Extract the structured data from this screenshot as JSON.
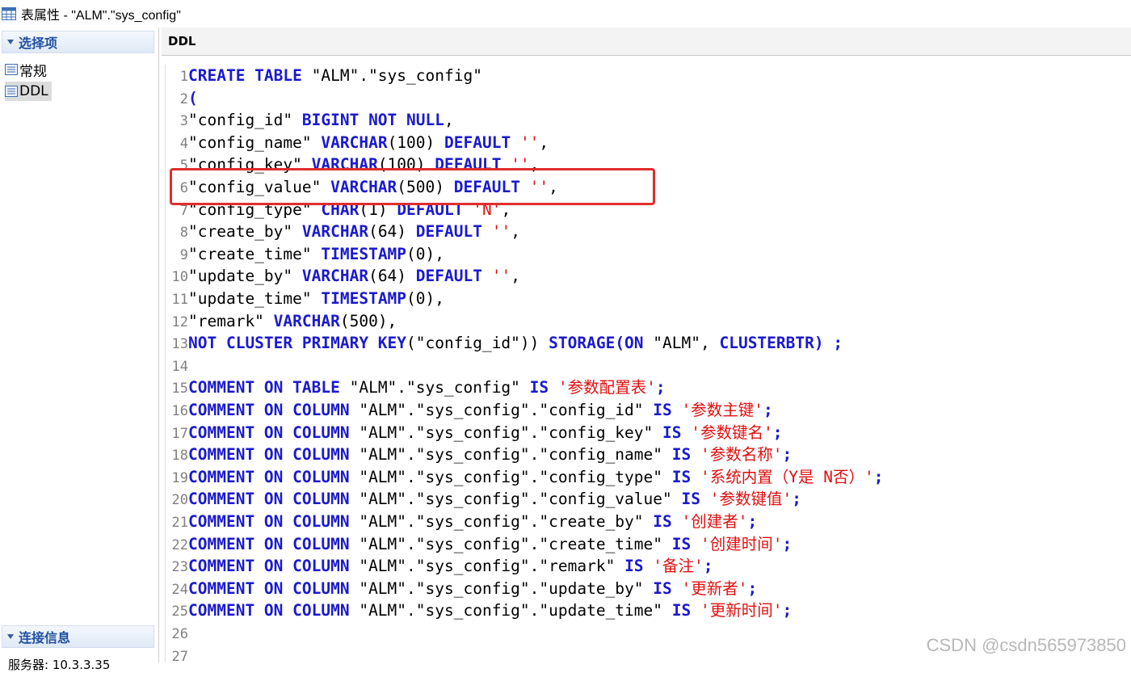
{
  "window": {
    "title": "表属性 - \"ALM\".\"sys_config\""
  },
  "sidebar": {
    "section_options": "选择项",
    "items": [
      {
        "label": "常规"
      },
      {
        "label": "DDL"
      }
    ],
    "section_connection": "连接信息",
    "connection_partial": "服务器: 10.3.3.35"
  },
  "tab": {
    "label": "DDL"
  },
  "ddl_lines": [
    [
      {
        "t": "CREATE TABLE ",
        "c": "kw"
      },
      {
        "t": "\"ALM\".\"sys_config\"",
        "c": "code"
      }
    ],
    [
      {
        "t": "(",
        "c": "kw"
      }
    ],
    [
      {
        "t": "\"config_id\" ",
        "c": "code"
      },
      {
        "t": "BIGINT NOT NULL",
        "c": "kw"
      },
      {
        "t": ",",
        "c": "code"
      }
    ],
    [
      {
        "t": "\"config_name\" ",
        "c": "code"
      },
      {
        "t": "VARCHAR",
        "c": "kw"
      },
      {
        "t": "(100) ",
        "c": "code"
      },
      {
        "t": "DEFAULT ",
        "c": "kw"
      },
      {
        "t": "''",
        "c": "str"
      },
      {
        "t": ",",
        "c": "code"
      }
    ],
    [
      {
        "t": "\"config_key\" ",
        "c": "code"
      },
      {
        "t": "VARCHAR",
        "c": "kw"
      },
      {
        "t": "(100) ",
        "c": "code"
      },
      {
        "t": "DEFAULT ",
        "c": "kw"
      },
      {
        "t": "''",
        "c": "str"
      },
      {
        "t": ",",
        "c": "code"
      }
    ],
    [
      {
        "t": "\"config_value\" ",
        "c": "code"
      },
      {
        "t": "VARCHAR",
        "c": "kw"
      },
      {
        "t": "(500) ",
        "c": "code"
      },
      {
        "t": "DEFAULT ",
        "c": "kw"
      },
      {
        "t": "''",
        "c": "str"
      },
      {
        "t": ",",
        "c": "code"
      }
    ],
    [
      {
        "t": "\"config_type\" ",
        "c": "code"
      },
      {
        "t": "CHAR",
        "c": "kw"
      },
      {
        "t": "(1) ",
        "c": "code"
      },
      {
        "t": "DEFAULT ",
        "c": "kw"
      },
      {
        "t": "'N'",
        "c": "str"
      },
      {
        "t": ",",
        "c": "code"
      }
    ],
    [
      {
        "t": "\"create_by\" ",
        "c": "code"
      },
      {
        "t": "VARCHAR",
        "c": "kw"
      },
      {
        "t": "(64) ",
        "c": "code"
      },
      {
        "t": "DEFAULT ",
        "c": "kw"
      },
      {
        "t": "''",
        "c": "str"
      },
      {
        "t": ",",
        "c": "code"
      }
    ],
    [
      {
        "t": "\"create_time\" ",
        "c": "code"
      },
      {
        "t": "TIMESTAMP",
        "c": "kw"
      },
      {
        "t": "(0),",
        "c": "code"
      }
    ],
    [
      {
        "t": "\"update_by\" ",
        "c": "code"
      },
      {
        "t": "VARCHAR",
        "c": "kw"
      },
      {
        "t": "(64) ",
        "c": "code"
      },
      {
        "t": "DEFAULT ",
        "c": "kw"
      },
      {
        "t": "''",
        "c": "str"
      },
      {
        "t": ",",
        "c": "code"
      }
    ],
    [
      {
        "t": "\"update_time\" ",
        "c": "code"
      },
      {
        "t": "TIMESTAMP",
        "c": "kw"
      },
      {
        "t": "(0),",
        "c": "code"
      }
    ],
    [
      {
        "t": "\"remark\" ",
        "c": "code"
      },
      {
        "t": "VARCHAR",
        "c": "kw"
      },
      {
        "t": "(500),",
        "c": "code"
      }
    ],
    [
      {
        "t": "NOT CLUSTER PRIMARY KEY",
        "c": "kw"
      },
      {
        "t": "(\"config_id\")) ",
        "c": "code"
      },
      {
        "t": "STORAGE(ON ",
        "c": "kw"
      },
      {
        "t": "\"ALM\", ",
        "c": "code"
      },
      {
        "t": "CLUSTERBTR) ;",
        "c": "kw"
      }
    ],
    [],
    [
      {
        "t": "COMMENT ON TABLE ",
        "c": "kw"
      },
      {
        "t": "\"ALM\".\"sys_config\" ",
        "c": "code"
      },
      {
        "t": "IS ",
        "c": "kw"
      },
      {
        "t": "'参数配置表'",
        "c": "str"
      },
      {
        "t": ";",
        "c": "kw"
      }
    ],
    [
      {
        "t": "COMMENT ON COLUMN ",
        "c": "kw"
      },
      {
        "t": "\"ALM\".\"sys_config\".\"config_id\" ",
        "c": "code"
      },
      {
        "t": "IS ",
        "c": "kw"
      },
      {
        "t": "'参数主键'",
        "c": "str"
      },
      {
        "t": ";",
        "c": "kw"
      }
    ],
    [
      {
        "t": "COMMENT ON COLUMN ",
        "c": "kw"
      },
      {
        "t": "\"ALM\".\"sys_config\".\"config_key\" ",
        "c": "code"
      },
      {
        "t": "IS ",
        "c": "kw"
      },
      {
        "t": "'参数键名'",
        "c": "str"
      },
      {
        "t": ";",
        "c": "kw"
      }
    ],
    [
      {
        "t": "COMMENT ON COLUMN ",
        "c": "kw"
      },
      {
        "t": "\"ALM\".\"sys_config\".\"config_name\" ",
        "c": "code"
      },
      {
        "t": "IS ",
        "c": "kw"
      },
      {
        "t": "'参数名称'",
        "c": "str"
      },
      {
        "t": ";",
        "c": "kw"
      }
    ],
    [
      {
        "t": "COMMENT ON COLUMN ",
        "c": "kw"
      },
      {
        "t": "\"ALM\".\"sys_config\".\"config_type\" ",
        "c": "code"
      },
      {
        "t": "IS ",
        "c": "kw"
      },
      {
        "t": "'系统内置（Y是 N否）'",
        "c": "str"
      },
      {
        "t": ";",
        "c": "kw"
      }
    ],
    [
      {
        "t": "COMMENT ON COLUMN ",
        "c": "kw"
      },
      {
        "t": "\"ALM\".\"sys_config\".\"config_value\" ",
        "c": "code"
      },
      {
        "t": "IS ",
        "c": "kw"
      },
      {
        "t": "'参数键值'",
        "c": "str"
      },
      {
        "t": ";",
        "c": "kw"
      }
    ],
    [
      {
        "t": "COMMENT ON COLUMN ",
        "c": "kw"
      },
      {
        "t": "\"ALM\".\"sys_config\".\"create_by\" ",
        "c": "code"
      },
      {
        "t": "IS ",
        "c": "kw"
      },
      {
        "t": "'创建者'",
        "c": "str"
      },
      {
        "t": ";",
        "c": "kw"
      }
    ],
    [
      {
        "t": "COMMENT ON COLUMN ",
        "c": "kw"
      },
      {
        "t": "\"ALM\".\"sys_config\".\"create_time\" ",
        "c": "code"
      },
      {
        "t": "IS ",
        "c": "kw"
      },
      {
        "t": "'创建时间'",
        "c": "str"
      },
      {
        "t": ";",
        "c": "kw"
      }
    ],
    [
      {
        "t": "COMMENT ON COLUMN ",
        "c": "kw"
      },
      {
        "t": "\"ALM\".\"sys_config\".\"remark\" ",
        "c": "code"
      },
      {
        "t": "IS ",
        "c": "kw"
      },
      {
        "t": "'备注'",
        "c": "str"
      },
      {
        "t": ";",
        "c": "kw"
      }
    ],
    [
      {
        "t": "COMMENT ON COLUMN ",
        "c": "kw"
      },
      {
        "t": "\"ALM\".\"sys_config\".\"update_by\" ",
        "c": "code"
      },
      {
        "t": "IS ",
        "c": "kw"
      },
      {
        "t": "'更新者'",
        "c": "str"
      },
      {
        "t": ";",
        "c": "kw"
      }
    ],
    [
      {
        "t": "COMMENT ON COLUMN ",
        "c": "kw"
      },
      {
        "t": "\"ALM\".\"sys_config\".\"update_time\" ",
        "c": "code"
      },
      {
        "t": "IS ",
        "c": "kw"
      },
      {
        "t": "'更新时间'",
        "c": "str"
      },
      {
        "t": ";",
        "c": "kw"
      }
    ],
    [],
    []
  ],
  "watermark": "CSDN @csdn565973850",
  "colors": {
    "keyword": "#1a1ad0",
    "string": "#e01010",
    "highlight": "#e22c2c"
  }
}
